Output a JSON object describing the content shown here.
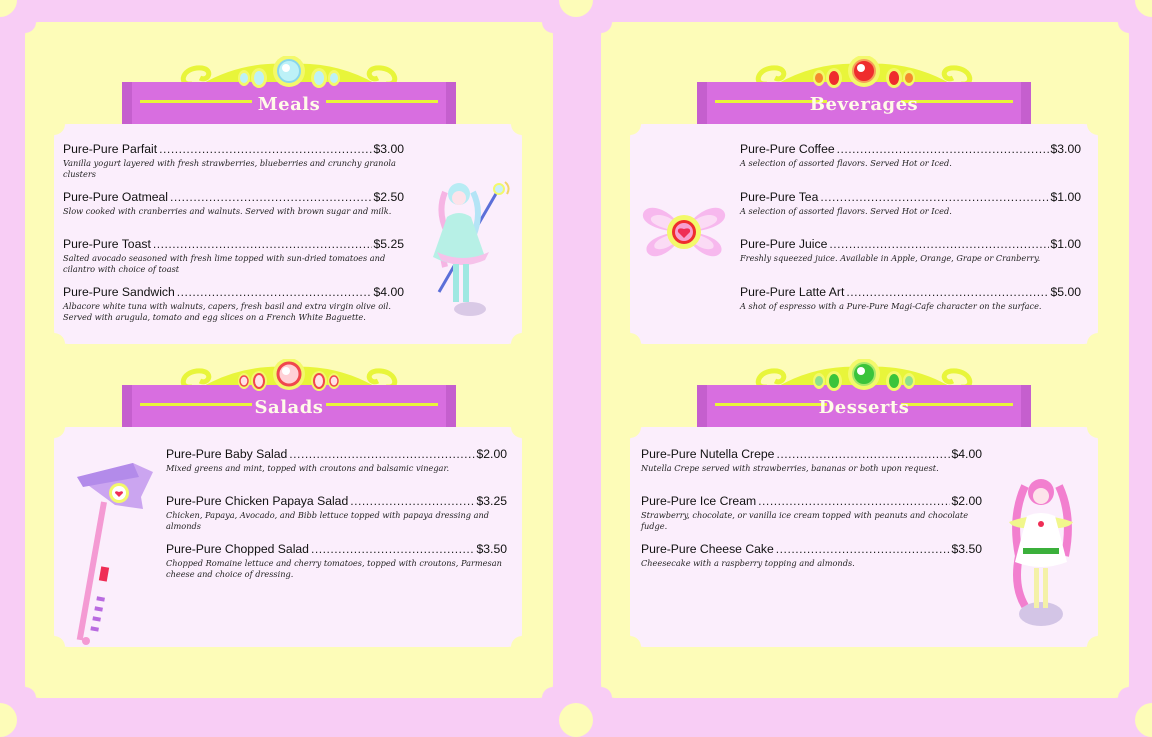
{
  "colors": {
    "background": "#f8cdf5",
    "page": "#fdfcb8",
    "card": "#fbeefc",
    "banner": "#d86ee0",
    "banner_text": "#fffbe8",
    "ornament": "#e8f53a"
  },
  "sections": {
    "meals": {
      "title": "Meals",
      "gem": "light-blue-gem-icon",
      "items": [
        {
          "name": "Pure-Pure Parfait",
          "price": "$3.00",
          "desc": "Vanilla yogurt layered with fresh strawberries, blueberries and crunchy granola clusters"
        },
        {
          "name": "Pure-Pure Oatmeal",
          "price": "$2.50",
          "desc": "Slow cooked with cranberries and walnuts. Served with brown sugar and milk."
        },
        {
          "name": "Pure-Pure Toast",
          "price": "$5.25",
          "desc": "Salted avocado seasoned with fresh lime topped with sun-dried tomatoes and cilantro with choice of toast"
        },
        {
          "name": "Pure-Pure Sandwich",
          "price": "$4.00",
          "desc": "Albacore white tuna with walnuts, capers, fresh basil and extra virgin olive oil. Served with arugula, tomato and egg slices on a French White Baguette."
        }
      ]
    },
    "salads": {
      "title": "Salads",
      "gem": "pink-gem-icon",
      "items": [
        {
          "name": "Pure-Pure Baby Salad",
          "price": "$2.00",
          "desc": "Mixed greens and mint, topped with croutons and balsamic vinegar."
        },
        {
          "name": "Pure-Pure Chicken Papaya Salad",
          "price": "$3.25",
          "desc": "Chicken, Papaya, Avocado, and Bibb lettuce topped with papaya dressing and almonds"
        },
        {
          "name": "Pure-Pure Chopped Salad",
          "price": "$3.50",
          "desc": "Chopped Romaine lettuce and cherry tomatoes, topped with croutons, Parmesan cheese and choice of dressing."
        }
      ]
    },
    "beverages": {
      "title": "Beverages",
      "gem": "red-gem-icon",
      "items": [
        {
          "name": "Pure-Pure Coffee",
          "price": "$3.00",
          "desc": "A selection of assorted flavors. Served Hot or Iced."
        },
        {
          "name": "Pure-Pure Tea",
          "price": "$1.00",
          "desc": "A selection of assorted flavors. Served Hot or Iced."
        },
        {
          "name": "Pure-Pure Juice",
          "price": "$1.00",
          "desc": "Freshly squeezed juice. Available in Apple, Orange, Grape or Cranberry."
        },
        {
          "name": "Pure-Pure Latte Art",
          "price": "$5.00",
          "desc": "A shot of espresso with a Pure-Pure Magi-Cafe character on the surface."
        }
      ]
    },
    "desserts": {
      "title": "Desserts",
      "gem": "green-gem-icon",
      "items": [
        {
          "name": "Pure-Pure Nutella Crepe",
          "price": "$4.00",
          "desc": "Nutella Crepe served with strawberries, bananas or both upon request."
        },
        {
          "name": "Pure-Pure Ice Cream",
          "price": "$2.00",
          "desc": "Strawberry, chocolate, or vanilla ice cream topped with peanuts and chocolate fudge."
        },
        {
          "name": "Pure-Pure Cheese Cake",
          "price": "$3.50",
          "desc": "Cheesecake with a raspberry topping and almonds."
        }
      ]
    }
  }
}
